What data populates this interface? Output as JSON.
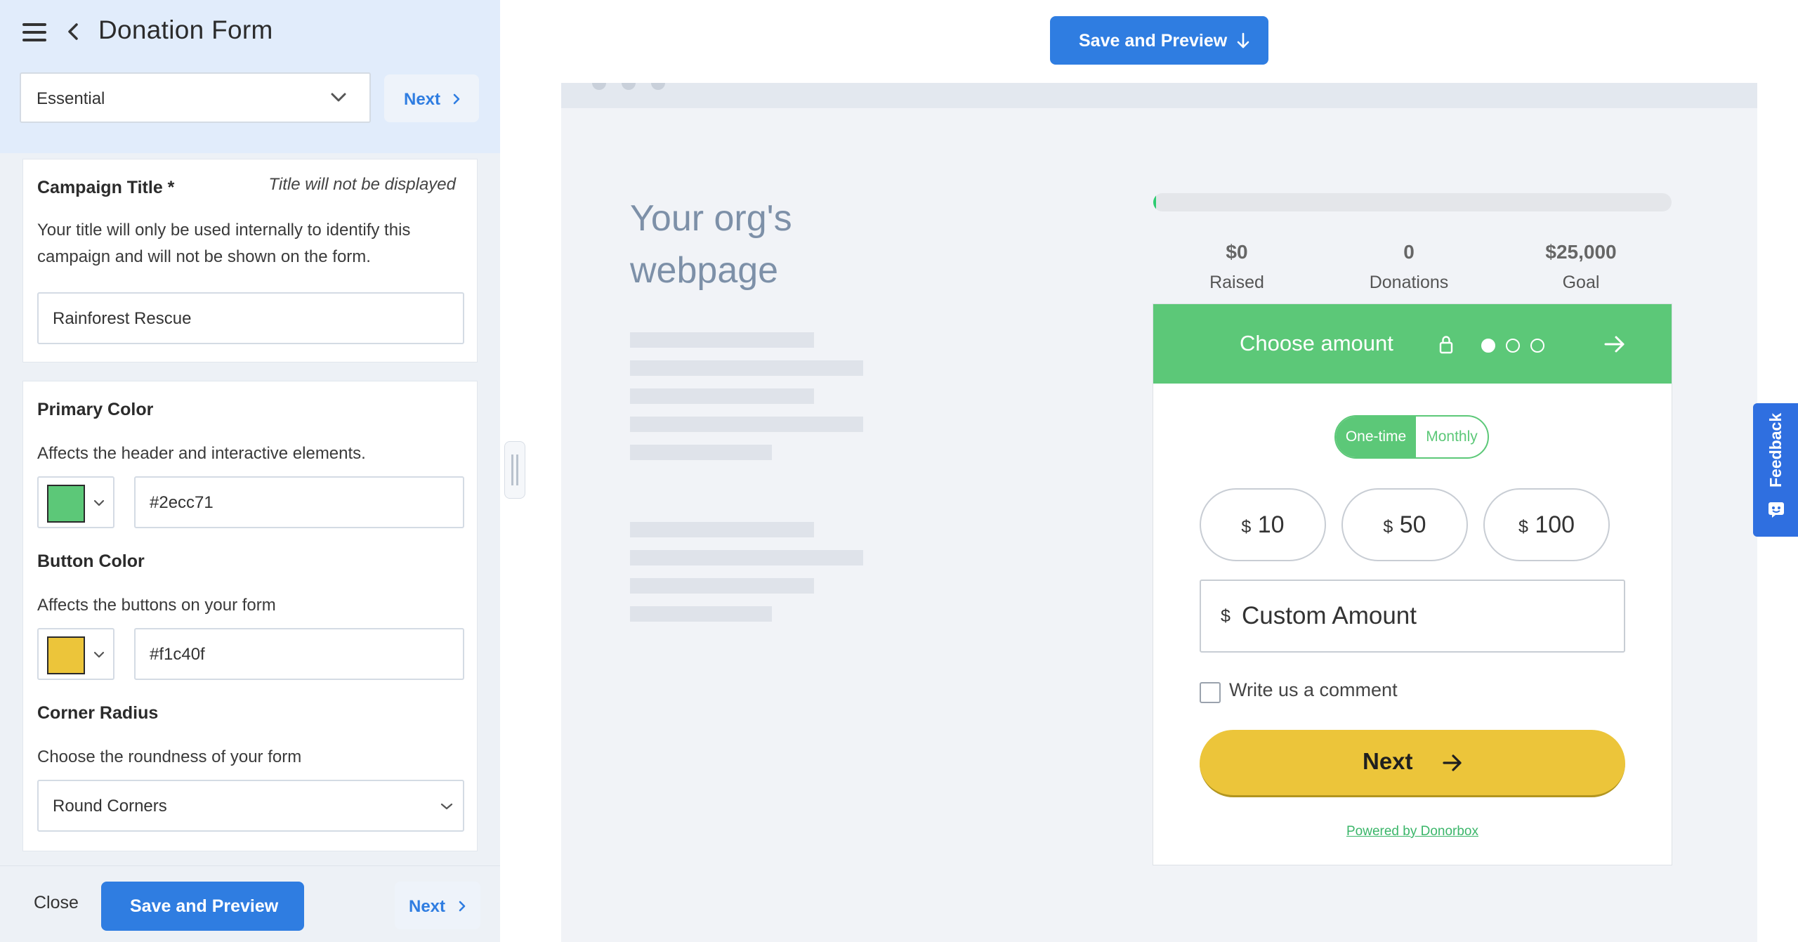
{
  "header": {
    "title": "Donation Form"
  },
  "plan_select": {
    "value": "Essential"
  },
  "nav": {
    "next_label": "Next"
  },
  "campaign": {
    "heading": "Campaign Title *",
    "note": "Title will not be displayed",
    "desc": "Your title will only be used internally to identify this campaign and will not be shown on the form.",
    "value": "Rainforest Rescue"
  },
  "primary_color": {
    "heading": "Primary Color",
    "desc": "Affects the header and interactive elements.",
    "value": "#2ecc71"
  },
  "button_color": {
    "heading": "Button Color",
    "desc": "Affects the buttons on your form",
    "value": "#f1c40f"
  },
  "corner_radius": {
    "heading": "Corner Radius",
    "desc": "Choose the roundness of your form",
    "value": "Round Corners"
  },
  "footer": {
    "close_label": "Close",
    "save_label": "Save and Preview",
    "next_label": "Next"
  },
  "preview": {
    "save_label": "Save and Preview",
    "org_text": "Your org's webpage",
    "progress_fraction": 0.006,
    "stats": [
      {
        "value": "$0",
        "label": "Raised"
      },
      {
        "value": "0",
        "label": "Donations"
      },
      {
        "value": "$25,000",
        "label": "Goal"
      }
    ],
    "form": {
      "title": "Choose amount",
      "step_current": 1,
      "step_total": 3,
      "frequency": [
        "One-time",
        "Monthly"
      ],
      "currency": "$",
      "amounts": [
        "10",
        "50",
        "100"
      ],
      "custom_placeholder": "Custom Amount",
      "comment_label": "Write us a comment",
      "next_label": "Next",
      "powered_by": "Powered by Donorbox"
    }
  },
  "feedback": {
    "label": "Feedback"
  },
  "colors": {
    "accent_blue": "#2f7de1",
    "form_green": "#5cc878",
    "button_yellow": "#ecc53a"
  }
}
